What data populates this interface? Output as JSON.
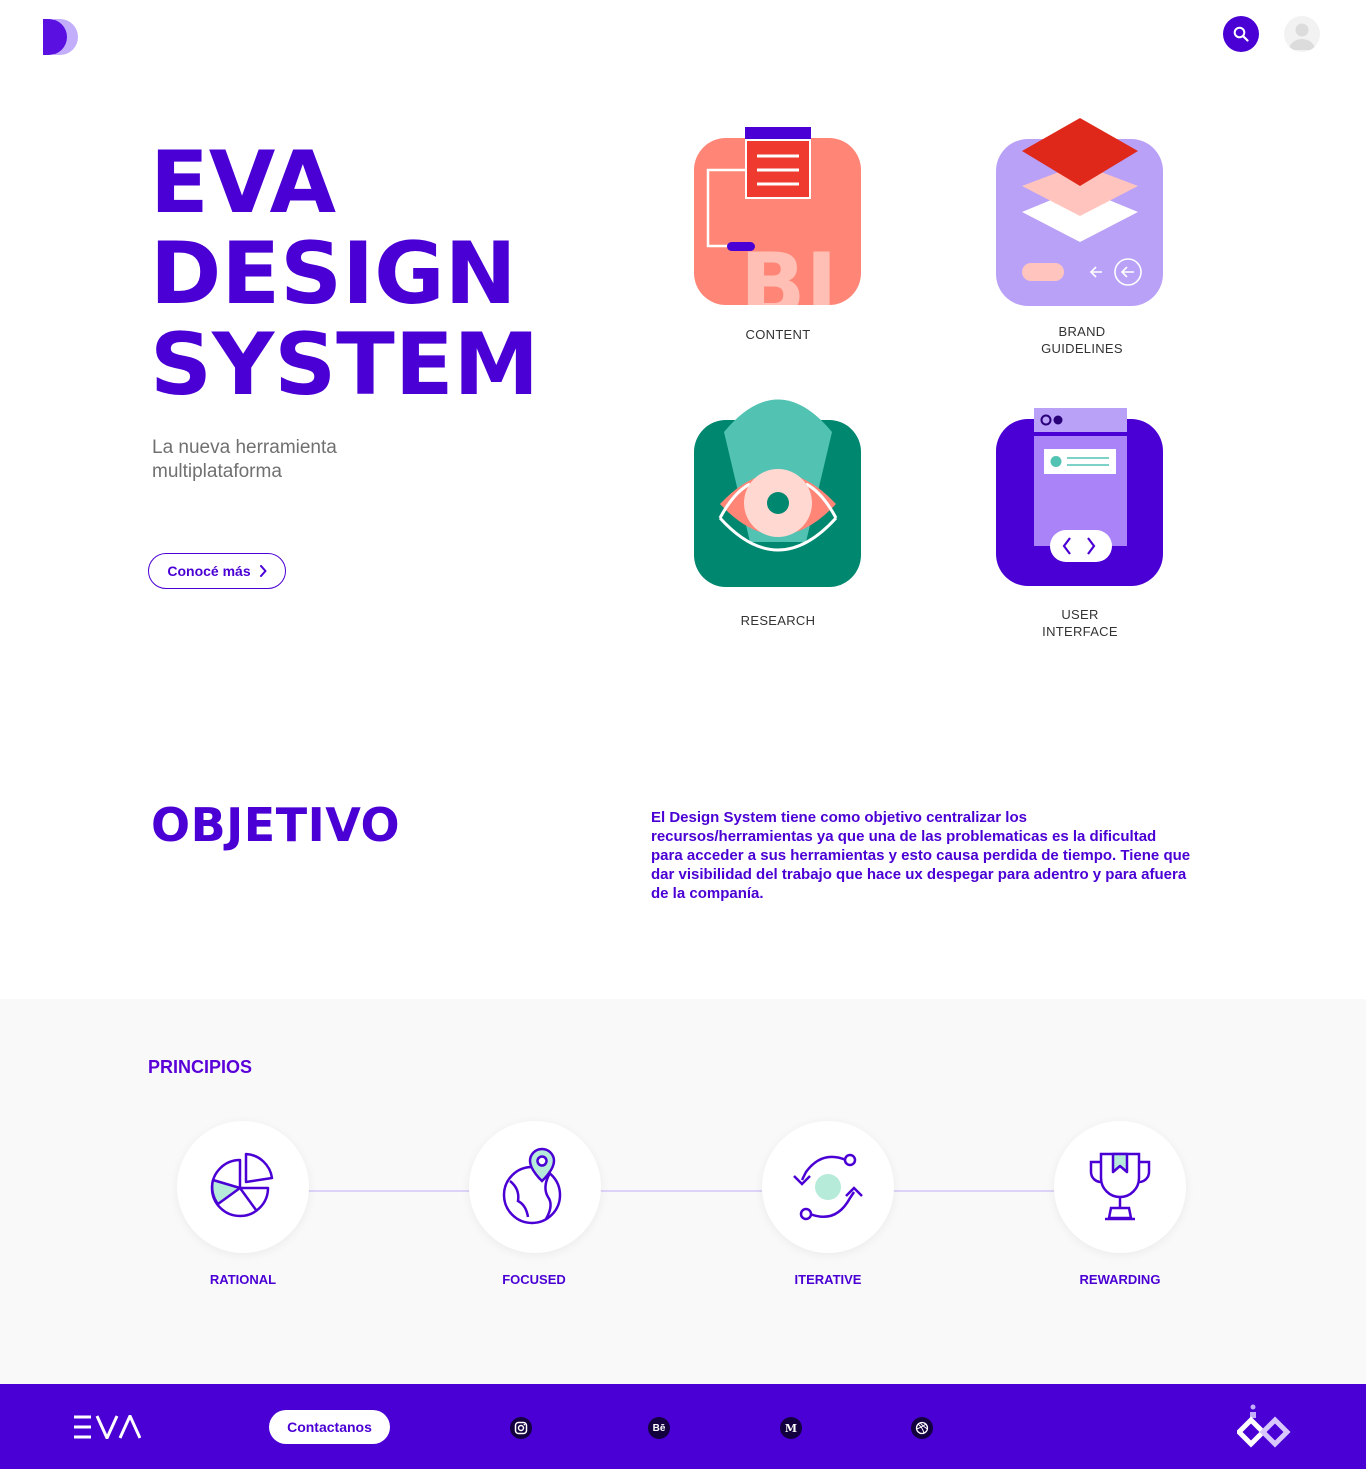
{
  "header": {
    "logo": "d-logo-icon",
    "search": "search-icon",
    "avatar": "user-avatar-icon"
  },
  "hero": {
    "title_lines": [
      "EVA",
      "DESIGN",
      "SYSTEM"
    ],
    "subtitle": "La nueva herramienta multiplataforma",
    "cta_label": "Conocé más"
  },
  "cards": {
    "content": "CONTENT",
    "brand_line1": "BRAND",
    "brand_line2": "GUIDELINES",
    "research": "RESEARCH",
    "ui_line1": "USER",
    "ui_line2": "INTERFACE"
  },
  "objetivo": {
    "title": "OBJETIVO",
    "text": "El Design System tiene como objetivo centralizar los recursos/herramientas ya que una de las problematicas es la dificultad para acceder a sus herramientas y esto causa perdida de tiempo. Tiene que dar visibilidad del trabajo que hace ux despegar para adentro y para afuera de la companía."
  },
  "principios": {
    "title": "PRINCIPIOS",
    "items": [
      {
        "label": "RATIONAL",
        "icon": "pie-chart-icon"
      },
      {
        "label": "FOCUSED",
        "icon": "globe-pin-icon"
      },
      {
        "label": "ITERATIVE",
        "icon": "cycle-arrows-icon"
      },
      {
        "label": "REWARDING",
        "icon": "trophy-icon"
      }
    ]
  },
  "footer": {
    "logo_text": "EVA",
    "contact_label": "Contactanos",
    "social": [
      {
        "name": "instagram-icon",
        "glyph": ""
      },
      {
        "name": "behance-icon",
        "glyph": "Bē"
      },
      {
        "name": "medium-icon",
        "glyph": "M"
      },
      {
        "name": "dribbble-icon",
        "glyph": ""
      }
    ]
  },
  "colors": {
    "primary": "#4a00d4",
    "coral": "#ff8577",
    "lavender": "#b9a1f7",
    "teal": "#00876f",
    "mint": "#b6ead9"
  }
}
